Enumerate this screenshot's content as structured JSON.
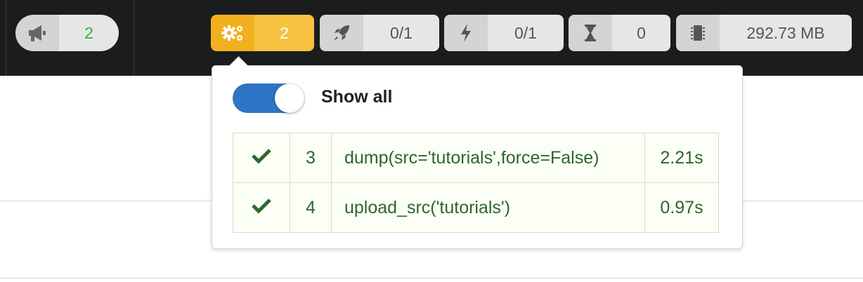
{
  "toolbar": {
    "announcements": {
      "icon": "megaphone-icon",
      "count": "2"
    },
    "jobs": {
      "icon": "gears-icon",
      "count": "2"
    },
    "deploys": {
      "icon": "rocket-icon",
      "value": "0/1"
    },
    "power": {
      "icon": "bolt-icon",
      "value": "0/1"
    },
    "pending": {
      "icon": "hourglass-icon",
      "value": "0"
    },
    "memory": {
      "icon": "chip-icon",
      "value": "292.73 MB"
    }
  },
  "popup": {
    "toggle_label": "Show all",
    "toggle_on": true,
    "tasks": [
      {
        "status_icon": "checkmark-icon",
        "id": "3",
        "command": "dump(src='tutorials',force=False)",
        "duration": "2.21s"
      },
      {
        "status_icon": "checkmark-icon",
        "id": "4",
        "command": "upload_src('tutorials')",
        "duration": "0.97s"
      }
    ]
  },
  "colors": {
    "accent_yellow": "#f7c240",
    "toggle_blue": "#2e75c5",
    "success_green": "#2c662d",
    "count_green": "#21ba45"
  }
}
